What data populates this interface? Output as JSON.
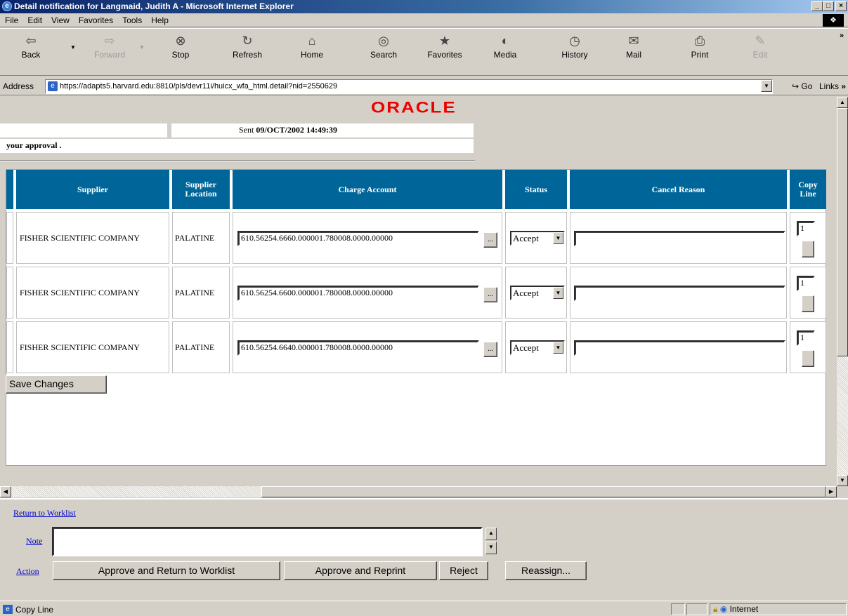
{
  "window": {
    "title": "Detail notification for Langmaid, Judith A - Microsoft Internet Explorer",
    "controls": [
      "_",
      "□",
      "×"
    ]
  },
  "menu": [
    "File",
    "Edit",
    "View",
    "Favorites",
    "Tools",
    "Help"
  ],
  "toolbar": [
    {
      "label": "Back",
      "icon": "back-arrow-icon",
      "glyph": "⇦"
    },
    {
      "label": "Forward",
      "icon": "forward-arrow-icon",
      "glyph": "⇨"
    },
    {
      "label": "Stop",
      "icon": "stop-icon",
      "glyph": "⊗"
    },
    {
      "label": "Refresh",
      "icon": "refresh-icon",
      "glyph": "↻"
    },
    {
      "label": "Home",
      "icon": "home-icon",
      "glyph": "⌂"
    },
    {
      "label": "Search",
      "icon": "search-icon",
      "glyph": "◎"
    },
    {
      "label": "Favorites",
      "icon": "favorites-icon",
      "glyph": "★"
    },
    {
      "label": "Media",
      "icon": "media-icon",
      "glyph": "◐"
    },
    {
      "label": "History",
      "icon": "history-icon",
      "glyph": "◷"
    },
    {
      "label": "Mail",
      "icon": "mail-icon",
      "glyph": "✉"
    },
    {
      "label": "Print",
      "icon": "print-icon",
      "glyph": "⎙"
    },
    {
      "label": "Edit",
      "icon": "edit-icon",
      "glyph": "✎"
    }
  ],
  "address": {
    "label": "Address",
    "url": "https://adapts5.harvard.edu:8810/pls/devr11i/huicx_wfa_html.detail?nid=2550629",
    "go": "Go",
    "links": "Links"
  },
  "page": {
    "logo": "ORACLE",
    "sent_label": "Sent",
    "sent_value": "09/OCT/2002 14:49:39",
    "message": "your approval ."
  },
  "table": {
    "headers": [
      "Supplier",
      "Supplier Location",
      "Charge Account",
      "Status",
      "Cancel Reason",
      "Copy Line"
    ],
    "rows": [
      {
        "supplier": "FISHER SCIENTIFIC COMPANY",
        "location": "PALATINE",
        "account": "610.56254.6660.000001.780008.0000.00000",
        "status": "Accept",
        "copy": "1"
      },
      {
        "supplier": "FISHER SCIENTIFIC COMPANY",
        "location": "PALATINE",
        "account": "610.56254.6600.000001.780008.0000.00000",
        "status": "Accept",
        "copy": "1"
      },
      {
        "supplier": "FISHER SCIENTIFIC COMPANY",
        "location": "PALATINE",
        "account": "610.56254.6640.000001.780008.0000.00000",
        "status": "Accept",
        "copy": "1"
      }
    ],
    "lov_label": "..."
  },
  "save_button": "Save Changes",
  "bottom": {
    "return_link": "Return to Worklist",
    "note_label": "Note",
    "action_label": "Action",
    "actions": [
      "Approve and Return to Worklist",
      "Approve and Reprint",
      "Reject",
      "Reassign..."
    ]
  },
  "status": {
    "text": "Copy Line",
    "zone": "Internet"
  }
}
